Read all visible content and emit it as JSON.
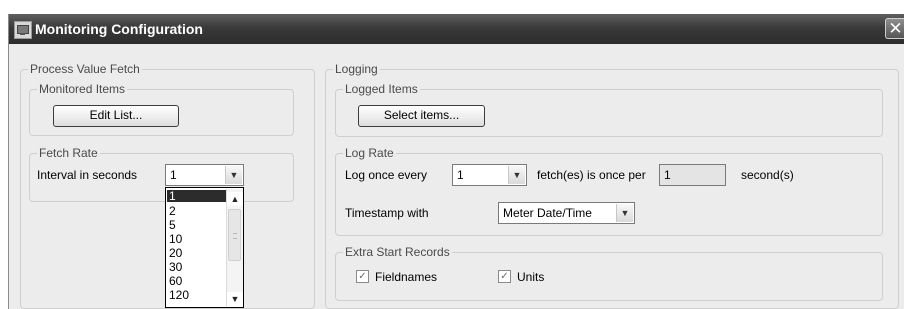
{
  "window": {
    "title": "Monitoring Configuration",
    "close_symbol": "✕"
  },
  "process_value_fetch": {
    "legend": "Process Value Fetch",
    "monitored_items": {
      "legend": "Monitored Items",
      "edit_button": "Edit  List..."
    },
    "fetch_rate": {
      "legend": "Fetch Rate",
      "interval_label": "Interval in seconds",
      "interval_value": "1",
      "options": [
        "1",
        "2",
        "5",
        "10",
        "20",
        "30",
        "60",
        "120"
      ],
      "selected_option": "1"
    }
  },
  "logging": {
    "legend": "Logging",
    "logged_items": {
      "legend": "Logged Items",
      "select_button": "Select items..."
    },
    "log_rate": {
      "legend": "Log Rate",
      "log_once_label": "Log once every",
      "log_once_value": "1",
      "fetches_label": "fetch(es) is once per",
      "seconds_value": "1",
      "seconds_label": "second(s)",
      "timestamp_label": "Timestamp with",
      "timestamp_value": "Meter Date/Time"
    },
    "extra_start_records": {
      "legend": "Extra Start Records",
      "fieldnames_label": "Fieldnames",
      "fieldnames_checked": true,
      "units_label": "Units",
      "units_checked": true
    }
  },
  "icons": {
    "dropdown_arrow": "▼",
    "scroll_up": "▲",
    "scroll_down": "▼",
    "check_mark": "✓"
  }
}
